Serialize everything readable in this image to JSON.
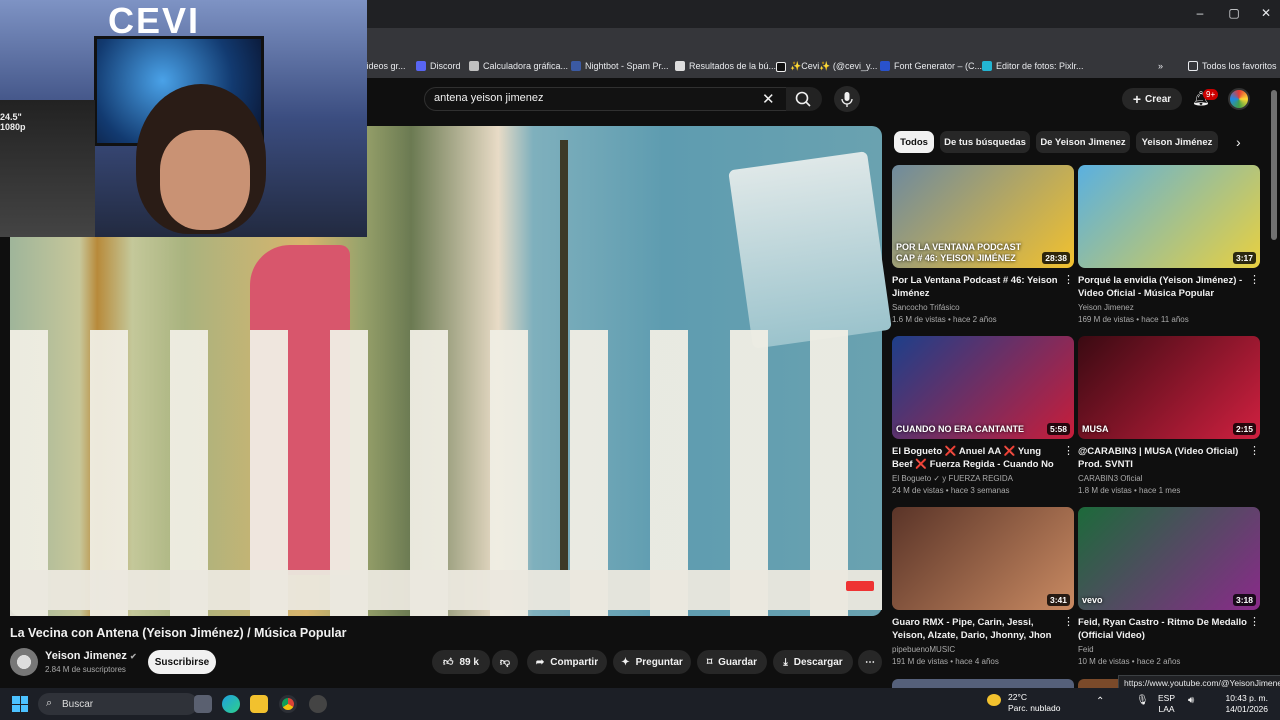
{
  "browser": {
    "window_controls": [
      "–",
      "▢",
      "✕"
    ],
    "bookmarks": [
      {
        "label": "videos gr...",
        "color": "#888888"
      },
      {
        "label": "Discord",
        "color": "#5865f2"
      },
      {
        "label": "Calculadora gráfica...",
        "color": "#c0c0c0"
      },
      {
        "label": "Nightbot - Spam Pr...",
        "color": "#3b5aa3"
      },
      {
        "label": "Resultados de la bú...",
        "color": "#dddddd"
      },
      {
        "label": "✨Cevi✨ (@cevi_y...",
        "color": "#111111"
      },
      {
        "label": "Font Generator – (C...",
        "color": "#2952cc"
      },
      {
        "label": "Editor de fotos: Pixlr...",
        "color": "#23b5d3"
      }
    ],
    "all_bookmarks": "Todos los favoritos"
  },
  "youtube": {
    "search": {
      "query": "antena yeison jimenez"
    },
    "create_label": "Crear",
    "notification_count": "9+"
  },
  "webcam": {
    "logo": "CEVI",
    "hz_label": "24.5\"\n1080p"
  },
  "video": {
    "title": "La Vecina con Antena (Yeison Jiménez) / Música Popular",
    "channel": "Yeison Jimenez",
    "subscribers": "2.84 M de suscriptores",
    "subscribe_label": "Suscribirse",
    "likes": "89 k",
    "share_label": "Compartir",
    "ask_label": "Preguntar",
    "save_label": "Guardar",
    "download_label": "Descargar"
  },
  "chips": [
    "Todos",
    "De tus búsquedas",
    "De Yeison Jimenez",
    "Yeison Jiménez"
  ],
  "recommendations": [
    {
      "title": "Por La Ventana Podcast # 46: Yeison Jiménez",
      "channel": "Sancocho Trifásico",
      "meta": "1.6 M de vistas • hace 2 años",
      "duration": "28:38",
      "thumb_text": "POR LA VENTANA PODCAST\nCAP # 46: YEISON JIMÉNEZ",
      "colors": [
        "#6e8a9e",
        "#f2c12e"
      ]
    },
    {
      "title": "Porqué la envidia (Yeison Jiménez) - Video Oficial - Música Popular",
      "channel": "Yeison Jimenez",
      "meta": "169 M de vistas • hace 11 años",
      "duration": "3:17",
      "thumb_text": "",
      "colors": [
        "#5ab0e0",
        "#e8d040"
      ]
    },
    {
      "title": "El Bogueto ❌ Anuel AA ❌ Yung Beef ❌ Fuerza Regida - Cuando No Era ...",
      "channel": "El Bogueto ✓ y FUERZA REGIDA",
      "meta": "24 M de vistas • hace 3 semanas",
      "duration": "5:58",
      "thumb_text": "CUANDO NO ERA CANTANTE",
      "colors": [
        "#1d3f8a",
        "#c81d3a"
      ]
    },
    {
      "title": "@CARABIN3   | MUSA (Video Oficial) Prod. SVNTI",
      "channel": "CARABIN3 Oficial",
      "meta": "1.8 M de vistas • hace 1 mes",
      "duration": "2:15",
      "thumb_text": "MUSA",
      "colors": [
        "#3a0a12",
        "#d02040"
      ]
    },
    {
      "title": "Guaro RMX - Pipe, Carin, Jessi, Yeison, Alzate, Dario, Jhonny, Jhon A, Luis A, ...",
      "channel": "pipebuenoMUSIC",
      "meta": "191 M de vistas • hace 4 años",
      "duration": "3:41",
      "thumb_text": "",
      "colors": [
        "#5a3428",
        "#c98a62"
      ]
    },
    {
      "title": "Feid, Ryan Castro - Ritmo De Medallo (Official Video)",
      "channel": "Feid",
      "meta": "10 M de vistas • hace 2 años",
      "duration": "3:18",
      "thumb_text": "vevo",
      "colors": [
        "#1c6a3a",
        "#8a2a8a"
      ]
    }
  ],
  "url_tooltip": "https://www.youtube.com/@YeisonJimenez",
  "taskbar": {
    "search_placeholder": "Buscar",
    "temperature": "22°C",
    "weather": "Parc. nublado",
    "lang1": "ESP",
    "lang2": "LAA",
    "time": "10:43 p. m.",
    "date": "14/01/2026"
  }
}
